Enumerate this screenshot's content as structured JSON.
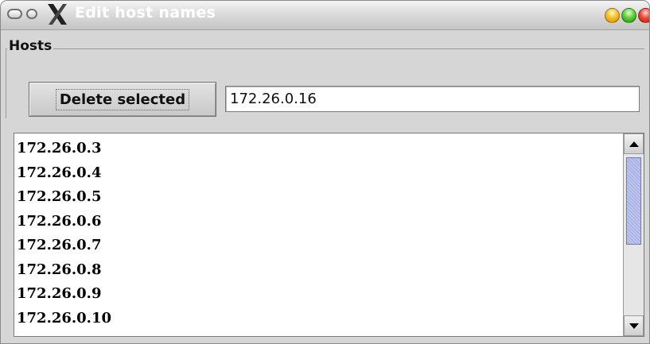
{
  "window": {
    "title": "Edit host names",
    "controls": [
      "minimize-yellow",
      "maximize-green",
      "close-red"
    ],
    "icon": "x-logo-icon"
  },
  "group": {
    "label": "Hosts"
  },
  "toolbar": {
    "delete_label": "Delete selected",
    "host_input_value": "172.26.0.16"
  },
  "hosts": {
    "items": [
      "172.26.0.3",
      "172.26.0.4",
      "172.26.0.5",
      "172.26.0.6",
      "172.26.0.7",
      "172.26.0.8",
      "172.26.0.9",
      "172.26.0.10"
    ]
  },
  "colors": {
    "window_bg": "#d6d6d6",
    "scroll_thumb": "#a9b3e6",
    "title_text": "#ffffff"
  }
}
